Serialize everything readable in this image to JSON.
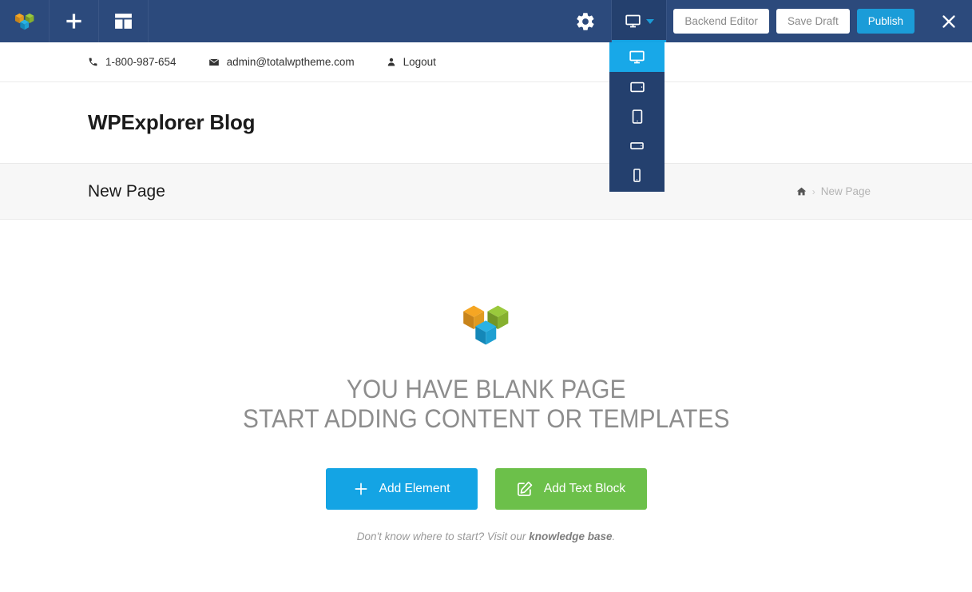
{
  "toolbar": {
    "logo_icon": "wpbakery-cubes-logo",
    "add_icon": "plus-icon",
    "templates_icon": "layout-templates-icon",
    "settings_icon": "gear-icon",
    "device_icon": "desktop-monitor-icon",
    "caret_icon": "caret-down-icon",
    "backend_editor_label": "Backend Editor",
    "save_draft_label": "Save Draft",
    "publish_label": "Publish",
    "close_icon": "close-x-icon",
    "bg_color": "#2c4a7c",
    "publish_color": "#1b9cd8",
    "active_underline_color": "#14a4e4"
  },
  "device_dropdown": {
    "active_color": "#18a8e8",
    "bg_color": "#24406e",
    "items": [
      {
        "name": "desktop",
        "icon": "desktop-monitor-icon",
        "active": true
      },
      {
        "name": "tablet-landscape",
        "icon": "tablet-landscape-icon",
        "active": false
      },
      {
        "name": "tablet-portrait",
        "icon": "tablet-portrait-icon",
        "active": false
      },
      {
        "name": "mobile-landscape",
        "icon": "mobile-landscape-icon",
        "active": false
      },
      {
        "name": "mobile-portrait",
        "icon": "mobile-portrait-icon",
        "active": false
      }
    ]
  },
  "site_topbar": {
    "phone": "1-800-987-654",
    "phone_icon": "phone-icon",
    "email": "admin@totalwptheme.com",
    "email_icon": "envelope-icon",
    "logout": "Logout",
    "logout_icon": "user-icon"
  },
  "site_header": {
    "title": "WPExplorer Blog"
  },
  "page_header": {
    "title": "New Page",
    "breadcrumb": {
      "home_icon": "home-icon",
      "separator": "›",
      "current": "New Page"
    }
  },
  "empty_state": {
    "logo_icon": "wpbakery-cubes-logo",
    "heading_line1": "YOU HAVE BLANK PAGE",
    "heading_line2": "START ADDING CONTENT OR TEMPLATES",
    "add_element_label": "Add Element",
    "add_element_icon": "plus-icon",
    "add_element_color": "#14a4e4",
    "add_text_block_label": "Add Text Block",
    "add_text_block_icon": "edit-pencil-square-icon",
    "add_text_block_color": "#6cc04a",
    "note_prefix": "Don't know where to start? Visit our ",
    "note_link": "knowledge base",
    "note_suffix": "."
  }
}
